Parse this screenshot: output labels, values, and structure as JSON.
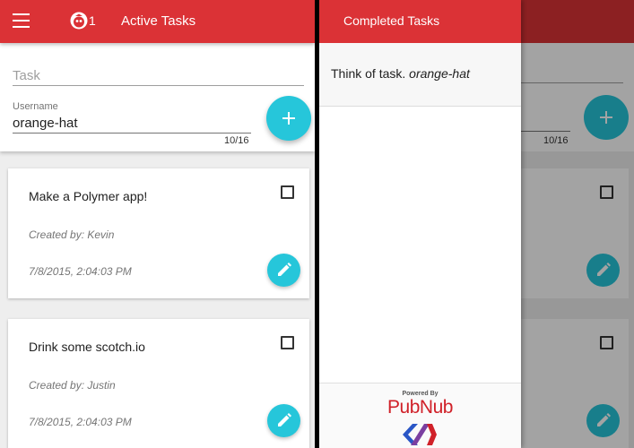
{
  "colors": {
    "toolbar": "#db3236",
    "fab": "#26c6da",
    "pubnub_red": "#d02129",
    "polymer_blue": "#2a56c6",
    "polymer_purple": "#7b3fa0"
  },
  "left": {
    "toolbar": {
      "menu_icon": "hamburger-menu-icon",
      "user_icon": "red-user-avatar-icon",
      "user_count": "1",
      "title": "Active Tasks"
    },
    "form": {
      "task_placeholder": "Task",
      "task_value": "",
      "username_label": "Username",
      "username_value": "orange-hat",
      "char_counter": "10/16",
      "add_icon": "plus-icon"
    },
    "tasks": [
      {
        "title": "Make a Polymer app!",
        "created_by": "Created by: Kevin",
        "date": "7/8/2015, 2:04:03 PM",
        "checked": false
      },
      {
        "title": "Drink some scotch.io",
        "created_by": "Created by: Justin",
        "date": "7/8/2015, 2:04:03 PM",
        "checked": false
      }
    ]
  },
  "right": {
    "background": {
      "char_counter": "10/16"
    },
    "drawer": {
      "title": "Completed Tasks",
      "items": [
        {
          "text": "Think of task.",
          "user": "orange-hat"
        }
      ],
      "powered_by": "Powered By",
      "brand": "PubNub"
    }
  }
}
